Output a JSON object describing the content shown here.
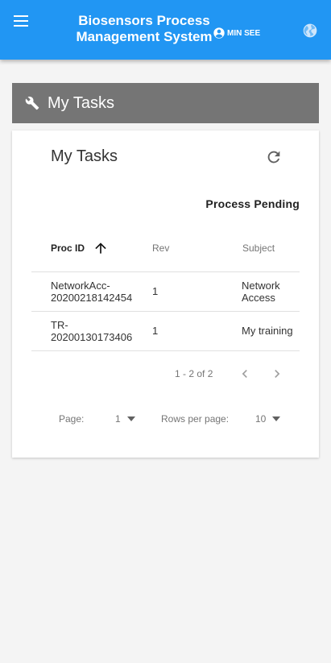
{
  "appbar": {
    "title": "Biosensors Process Management System",
    "user_name": "MIN SEE",
    "accent_color": "#2196f3",
    "icons": [
      "menu-icon",
      "account-circle-icon",
      "globe-icon"
    ]
  },
  "section": {
    "title": "My Tasks",
    "icon": "wrench-icon",
    "background": "#757575"
  },
  "card": {
    "title": "My Tasks",
    "refresh_icon": "refresh-icon",
    "status": "Process Pending"
  },
  "table": {
    "columns": [
      "Proc ID",
      "Rev",
      "Subject"
    ],
    "sort_icon": "arrow-up-icon",
    "rows": [
      {
        "proc_id": "NetworkAcc-20200218142454",
        "rev": "1",
        "subject": "Network Access"
      },
      {
        "proc_id": "TR-20200130173406",
        "rev": "1",
        "subject": "My training"
      }
    ]
  },
  "pagination": {
    "range": "1 - 2 of 2",
    "page_label": "Page:",
    "page_value": "1",
    "rows_label": "Rows per page:",
    "rows_value": "10",
    "icons": [
      "chevron-left-icon",
      "chevron-right-icon",
      "caret-down-icon"
    ]
  }
}
